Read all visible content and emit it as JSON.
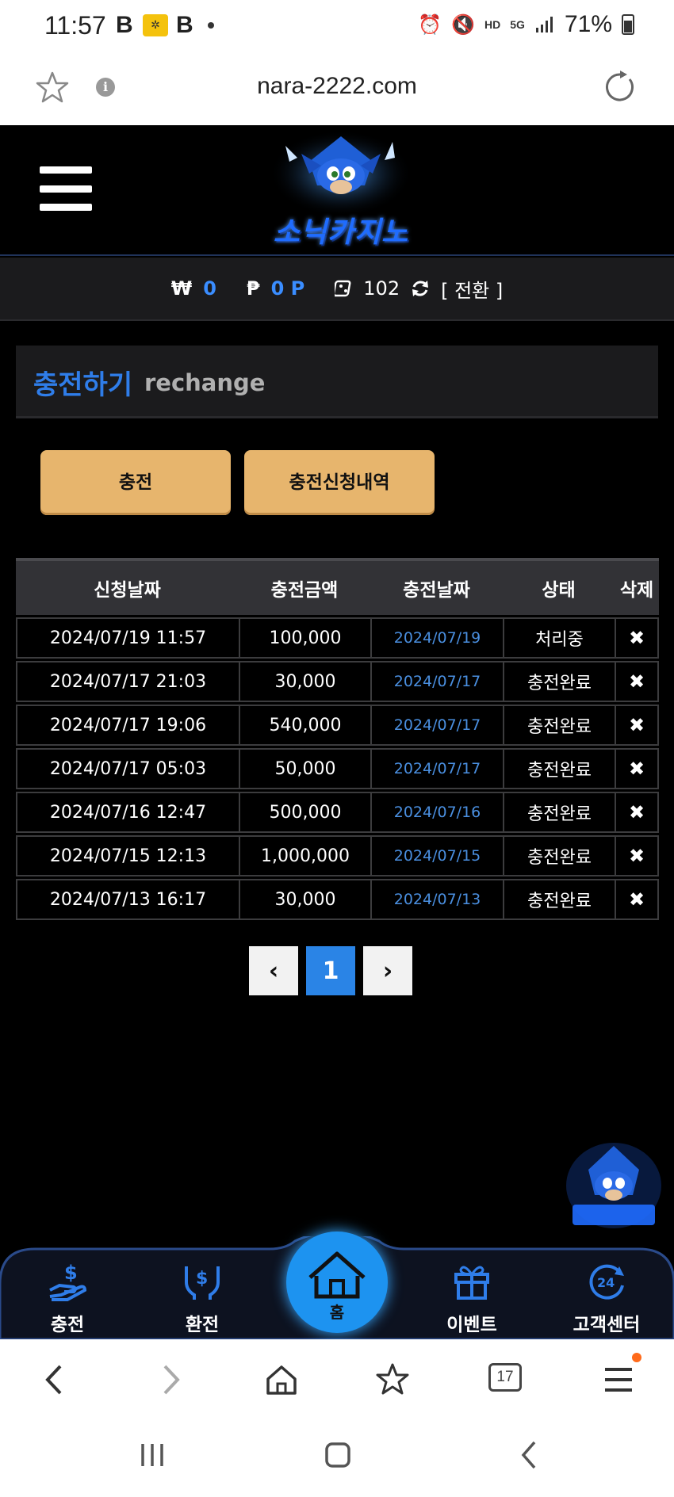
{
  "status_bar": {
    "time": "11:57",
    "battery_text": "71%",
    "signal_label": "5G",
    "hd_label": "HD"
  },
  "browser": {
    "url": "nara-2222.com",
    "tabs_count": "17"
  },
  "site": {
    "logo_text": "소닉카지노",
    "balance": {
      "won_symbol": "₩",
      "won_value": "0",
      "point_symbol": "₱",
      "point_value": "0 P",
      "chip_value": "102",
      "convert_label": "[ 전환 ]"
    },
    "panel": {
      "title_ko": "충전하기",
      "title_en": "rechange"
    },
    "buttons": {
      "charge": "충전",
      "history": "충전신청내역"
    },
    "table": {
      "headers": [
        "신청날짜",
        "충전금액",
        "충전날짜",
        "상태",
        "삭제"
      ],
      "rows": [
        {
          "requested": "2024/07/19 11:57",
          "amount": "100,000",
          "charged": "2024/07/19",
          "status": "처리중",
          "delete": "✖"
        },
        {
          "requested": "2024/07/17 21:03",
          "amount": "30,000",
          "charged": "2024/07/17",
          "status": "충전완료",
          "delete": "✖"
        },
        {
          "requested": "2024/07/17 19:06",
          "amount": "540,000",
          "charged": "2024/07/17",
          "status": "충전완료",
          "delete": "✖"
        },
        {
          "requested": "2024/07/17 05:03",
          "amount": "50,000",
          "charged": "2024/07/17",
          "status": "충전완료",
          "delete": "✖"
        },
        {
          "requested": "2024/07/16 12:47",
          "amount": "500,000",
          "charged": "2024/07/16",
          "status": "충전완료",
          "delete": "✖"
        },
        {
          "requested": "2024/07/15 12:13",
          "amount": "1,000,000",
          "charged": "2024/07/15",
          "status": "충전완료",
          "delete": "✖"
        },
        {
          "requested": "2024/07/13 16:17",
          "amount": "30,000",
          "charged": "2024/07/13",
          "status": "충전완료",
          "delete": "✖"
        }
      ]
    },
    "pagination": {
      "prev": "‹",
      "current": "1",
      "next": "›"
    },
    "bottom_nav": {
      "charge": "충전",
      "exchange": "환전",
      "home": "홈",
      "event": "이벤트",
      "support": "고객센터"
    }
  },
  "colors": {
    "accent_blue": "#2f7de9",
    "button_gold": "#e7b56d",
    "home_blue": "#1d93f0"
  }
}
